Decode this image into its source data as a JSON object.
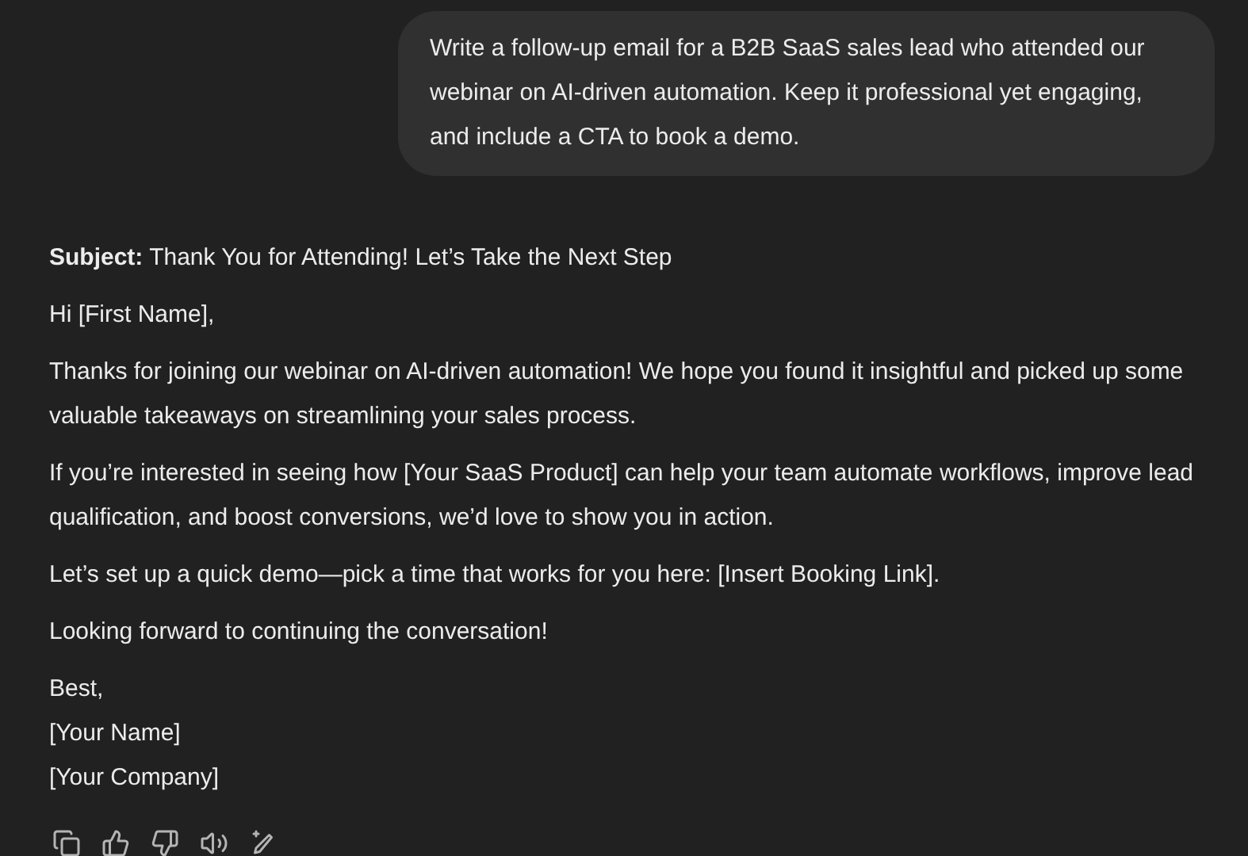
{
  "user_message": "Write a follow-up email for a B2B SaaS sales lead who attended our webinar on AI-driven automation. Keep it professional yet engaging, and include a CTA to book a demo.",
  "response": {
    "paragraphs": [
      "**Subject:** Thank You for Attending! Let’s Take the Next Step",
      "Hi [First Name],",
      "Thanks for joining our webinar on AI-driven automation! We hope you found it insightful and picked up some valuable takeaways on streamlining your sales process.",
      "If you’re interested in seeing how [Your SaaS Product] can help your team automate workflows, improve lead qualification, and boost conversions, we’d love to show you in action.",
      "Let’s set up a quick demo—pick a time that works for you here: [Insert Booking Link].",
      "Looking forward to continuing the conversation!"
    ],
    "signature": [
      "Best,",
      "[Your Name]",
      "[Your Company]"
    ]
  },
  "actions": [
    {
      "kind": "copy"
    },
    {
      "kind": "like"
    },
    {
      "kind": "dislike"
    },
    {
      "kind": "read-aloud"
    },
    {
      "kind": "edit"
    }
  ]
}
